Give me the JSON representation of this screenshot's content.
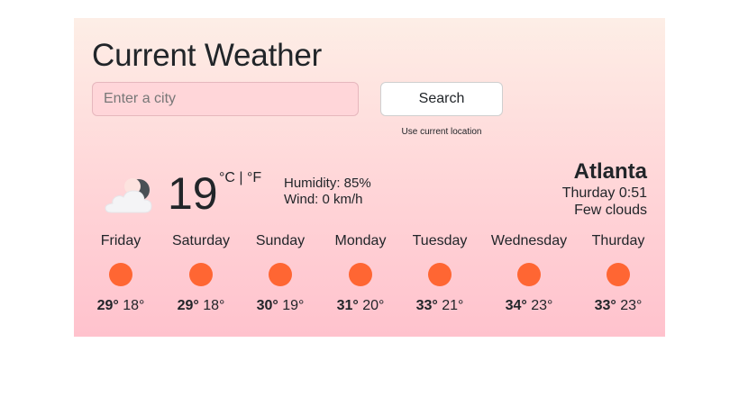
{
  "title": "Current Weather",
  "search": {
    "placeholder": "Enter a city",
    "value": "",
    "button_label": "Search",
    "location_link": "Use current location"
  },
  "current": {
    "icon": "cloud-moon-icon",
    "temperature": "19",
    "unit_c": "°C",
    "unit_separator": " | ",
    "unit_f": "°F",
    "humidity": "Humidity: 85%",
    "wind": "Wind: 0 km/h",
    "city": "Atlanta",
    "datetime": "Thurday 0:51",
    "description": "Few clouds"
  },
  "forecast": [
    {
      "day": "Friday",
      "max": "29°",
      "min": "18°",
      "icon": "sun-icon"
    },
    {
      "day": "Saturday",
      "max": "29°",
      "min": "18°",
      "icon": "sun-icon"
    },
    {
      "day": "Sunday",
      "max": "30°",
      "min": "19°",
      "icon": "sun-icon"
    },
    {
      "day": "Monday",
      "max": "31°",
      "min": "20°",
      "icon": "sun-icon"
    },
    {
      "day": "Tuesday",
      "max": "33°",
      "min": "21°",
      "icon": "sun-icon"
    },
    {
      "day": "Wednesday",
      "max": "34°",
      "min": "23°",
      "icon": "sun-icon"
    },
    {
      "day": "Thurday",
      "max": "33°",
      "min": "23°",
      "icon": "sun-icon"
    }
  ],
  "colors": {
    "card_top": "#fdeee6",
    "card_bottom": "#ffc2cd",
    "sun": "#ff6633",
    "text": "#212529"
  }
}
